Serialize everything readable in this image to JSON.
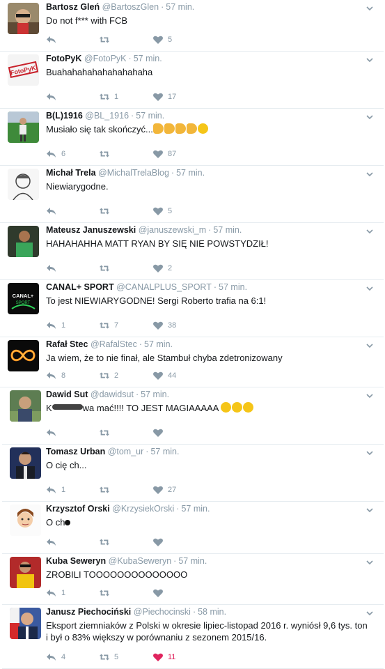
{
  "tweets": [
    {
      "name": "Bartosz Gleń",
      "handle": "@BartoszGlen",
      "time": "57 min.",
      "text": "Do not f*** with FCB",
      "replies": "",
      "retweets": "",
      "likes": "5",
      "avatar": "person-with-sunglasses"
    },
    {
      "name": "FotoPyK",
      "handle": "@FotoPyK",
      "time": "57 min.",
      "text": "Buahahahahahahahahaha",
      "replies": "",
      "retweets": "1",
      "likes": "17",
      "avatar": "fotopyk-stamp-logo"
    },
    {
      "name": "B(L)1916",
      "handle": "@BL_1916",
      "time": "57 min.",
      "text": "Musiało się tak skończyć...",
      "text_emoji": [
        "thumbs-up",
        "clapping-hands",
        "clapping-hands",
        "clapping-hands",
        "winking-face"
      ],
      "replies": "6",
      "retweets": "",
      "likes": "87",
      "avatar": "footballer-on-pitch"
    },
    {
      "name": "Michał Trela",
      "handle": "@MichalTrelaBlog",
      "time": "57 min.",
      "text": "Niewiarygodne.",
      "replies": "",
      "retweets": "",
      "likes": "5",
      "avatar": "sketch-portrait"
    },
    {
      "name": "Mateusz Januszewski",
      "handle": "@januszewski_m",
      "time": "57 min.",
      "text": "HAHAHAHHA MATT RYAN BY SIĘ NIE POWSTYDZIŁ!",
      "replies": "",
      "retweets": "",
      "likes": "2",
      "avatar": "man-in-green-kit"
    },
    {
      "name": "CANAL+ SPORT",
      "handle": "@CANALPLUS_SPORT",
      "time": "57 min.",
      "text": "To jest NIEWIARYGODNE! Sergi Roberto trafia na 6:1!",
      "replies": "1",
      "retweets": "7",
      "likes": "38",
      "avatar": "canal-plus-sport-logo",
      "avatar_text": "CANAL+ SPORT"
    },
    {
      "name": "Rafał Stec",
      "handle": "@RafalStec",
      "time": "57 min.",
      "text": "Ja wiem, że to nie finał, ale Stambuł chyba zdetronizowany",
      "replies": "8",
      "retweets": "2",
      "likes": "44",
      "avatar": "fire-infinity-symbol"
    },
    {
      "name": "Dawid Sut",
      "handle": "@dawidsut",
      "time": "57 min.",
      "text_before": "K",
      "text_after": "wa mać!!!! TO JEST MAGIAAAAA",
      "text_emoji": [
        "grinning-face",
        "grinning-face",
        "grinning-face"
      ],
      "replies": "",
      "retweets": "",
      "likes": "",
      "avatar": "man-outdoors"
    },
    {
      "name": "Tomasz Urban",
      "handle": "@tom_ur",
      "time": "57 min.",
      "text": "O cię ch...",
      "replies": "1",
      "retweets": "",
      "likes": "27",
      "avatar": "man-in-suit-studio"
    },
    {
      "name": "Krzysztof Orski",
      "handle": "@KrzysiekOrski",
      "time": "57 min.",
      "text": "O ch",
      "replies": "",
      "retweets": "",
      "likes": "",
      "avatar": "cartoon-portrait"
    },
    {
      "name": "Kuba Seweryn",
      "handle": "@KubaSeweryn",
      "time": "57 min.",
      "text": "ZROBILI TOOOOOOOOOOOOOO",
      "replies": "1",
      "retweets": "",
      "likes": "",
      "avatar": "man-in-yellow-kit"
    },
    {
      "name": "Janusz Piechociński",
      "handle": "@Piechocinski",
      "time": "58 min.",
      "text": "Eksport ziemniaków z Polski w okresie lipiec-listopad 2016 r. wyniósł 9,6 tys. ton i był o 83% większy w porównaniu z sezonem 2015/16.",
      "replies": "4",
      "retweets": "5",
      "likes": "11",
      "liked": true,
      "avatar": "man-in-suit-flag"
    }
  ],
  "colors": {
    "meta": "#8899a6",
    "text": "#14171a",
    "like_active": "#e0245e",
    "divider": "#e6ecf0"
  }
}
